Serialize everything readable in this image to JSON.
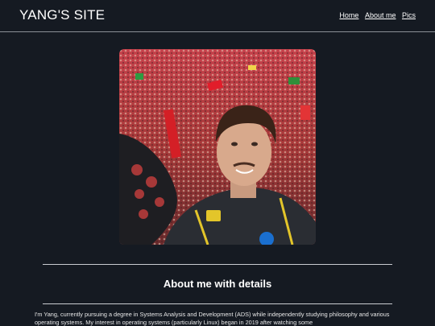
{
  "header": {
    "site_title": "YANG'S SITE",
    "nav": [
      {
        "label": "Home"
      },
      {
        "label": "About me"
      },
      {
        "label": "Pics"
      }
    ]
  },
  "hero_image": {
    "alt": "Selfie in front of a large crowd of fans"
  },
  "about": {
    "heading": "About me with details",
    "bio": "I'm Yang, currently pursuing a degree in Systems Analysis and Development (ADS) while independently studying philosophy and various operating systems. My interest in operating systems (particularly Linux) began in 2019 after watching some"
  },
  "colors": {
    "background": "#151a22",
    "text": "#ffffff",
    "divider": "#c9ccd1"
  }
}
